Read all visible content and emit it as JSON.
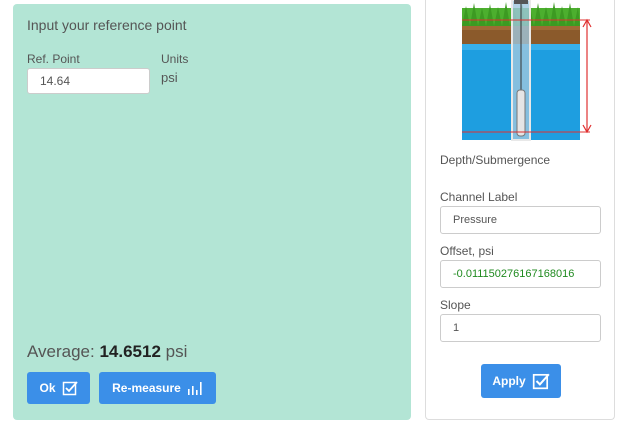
{
  "left": {
    "title": "Input your reference point",
    "ref_point_label": "Ref. Point",
    "units_label": "Units",
    "ref_point_value": "14.64",
    "units_value": "psi",
    "average_label": "Average:",
    "average_value": "14.6512",
    "average_unit": "psi",
    "ok_button": "Ok",
    "remeasure_button": "Re-measure"
  },
  "right": {
    "depth_label": "Depth/Submergence",
    "channel_label": "Channel Label",
    "channel_value": "Pressure",
    "offset_label": "Offset, psi",
    "offset_value": "-0.011150276167168016",
    "slope_label": "Slope",
    "slope_value": "1",
    "apply_button": "Apply"
  },
  "colors": {
    "panel_green": "#b3e5d5",
    "button_blue": "#3b8fe8",
    "water_blue": "#1e9ee0",
    "offset_text": "#1f8a1f",
    "measure_line": "#e03030"
  }
}
